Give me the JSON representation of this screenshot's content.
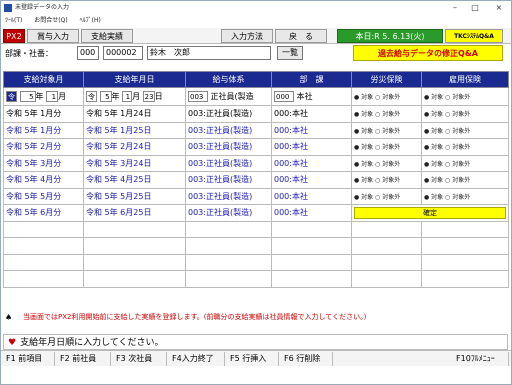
{
  "window": {
    "title": "未登録データの入力"
  },
  "menu": [
    "ﾂｰﾙ(T)",
    "お問合せ(Q)",
    "ﾍﾙﾌﾟ(H)"
  ],
  "toolbar": {
    "px2": "PX2",
    "bonus": "賞与入力",
    "payment": "支給実績",
    "method": "入力方法",
    "back": "戻　る",
    "today": "本日:R 5. 6.13(火)",
    "tkc": "TKCｼｽﾃﾑQ&A"
  },
  "employee": {
    "label": "部課・社番：",
    "dept": "000",
    "no": "000002",
    "name": "鈴木　次郎",
    "list_btn": "一覧",
    "fix_btn": "過去給与データの修正Q&A"
  },
  "table": {
    "headers": [
      "支給対象月",
      "支給年月日",
      "給与体系",
      "部　課",
      "労災保険",
      "雇用保険"
    ],
    "input_row": {
      "era1": "令",
      "year1": "5",
      "unit_year": "年",
      "month1": "1",
      "unit_month": "月",
      "era2": "令",
      "year2": "5",
      "month2": "1",
      "day2": "23",
      "unit_day": "日",
      "kei_code": "003",
      "kei_name": "正社員(製造",
      "dept_code": "000",
      "dept_name": "本社",
      "rousai": "● 対象 ○ 対象外",
      "koyou": "● 対象 ○ 対象外"
    },
    "rows": [
      {
        "month": "令和 5年 1月分",
        "date": "令和 5年 1月24日",
        "kei": "003:正社員(製造)",
        "dept": "000:本社",
        "rousai": "● 対象 ○ 対象外",
        "koyou": "● 対象 ○ 対象外"
      },
      {
        "month": "令和 5年 1月分",
        "date": "令和 5年 1月25日",
        "kei": "003:正社員(製造)",
        "dept": "000:本社",
        "rousai": "● 対象 ○ 対象外",
        "koyou": "● 対象 ○ 対象外"
      },
      {
        "month": "令和 5年 2月分",
        "date": "令和 5年 2月24日",
        "kei": "003:正社員(製造)",
        "dept": "000:本社",
        "rousai": "● 対象 ○ 対象外",
        "koyou": "● 対象 ○ 対象外"
      },
      {
        "month": "令和 5年 3月分",
        "date": "令和 5年 3月24日",
        "kei": "003:正社員(製造)",
        "dept": "000:本社",
        "rousai": "● 対象 ○ 対象外",
        "koyou": "● 対象 ○ 対象外"
      },
      {
        "month": "令和 5年 4月分",
        "date": "令和 5年 4月25日",
        "kei": "003:正社員(製造)",
        "dept": "000:本社",
        "rousai": "● 対象 ○ 対象外",
        "koyou": "● 対象 ○ 対象外"
      },
      {
        "month": "令和 5年 5月分",
        "date": "令和 5年 5月25日",
        "kei": "003:正社員(製造)",
        "dept": "000:本社",
        "rousai": "● 対象 ○ 対象外",
        "koyou": "● 対象 ○ 対象外"
      },
      {
        "month": "令和 5年 6月分",
        "date": "令和 5年 6月25日",
        "kei": "003:正社員(製造)",
        "dept": "000:本社",
        "rousai": "",
        "koyou": ""
      }
    ],
    "kakutei": "確定"
  },
  "notice": "当画面ではPX2利用開始前に支給した実績を登録します。(前職分の支給実績は社員情報で入力してください。)",
  "message": "支給年月日順に入力してください。",
  "fkeys": [
    "F1 前項目",
    "F2 前社員",
    "F3 次社員",
    "F4入力終了",
    "F5 行挿入",
    "F6 行削除",
    "F10ﾌﾙﾒﾆｭｰ"
  ]
}
